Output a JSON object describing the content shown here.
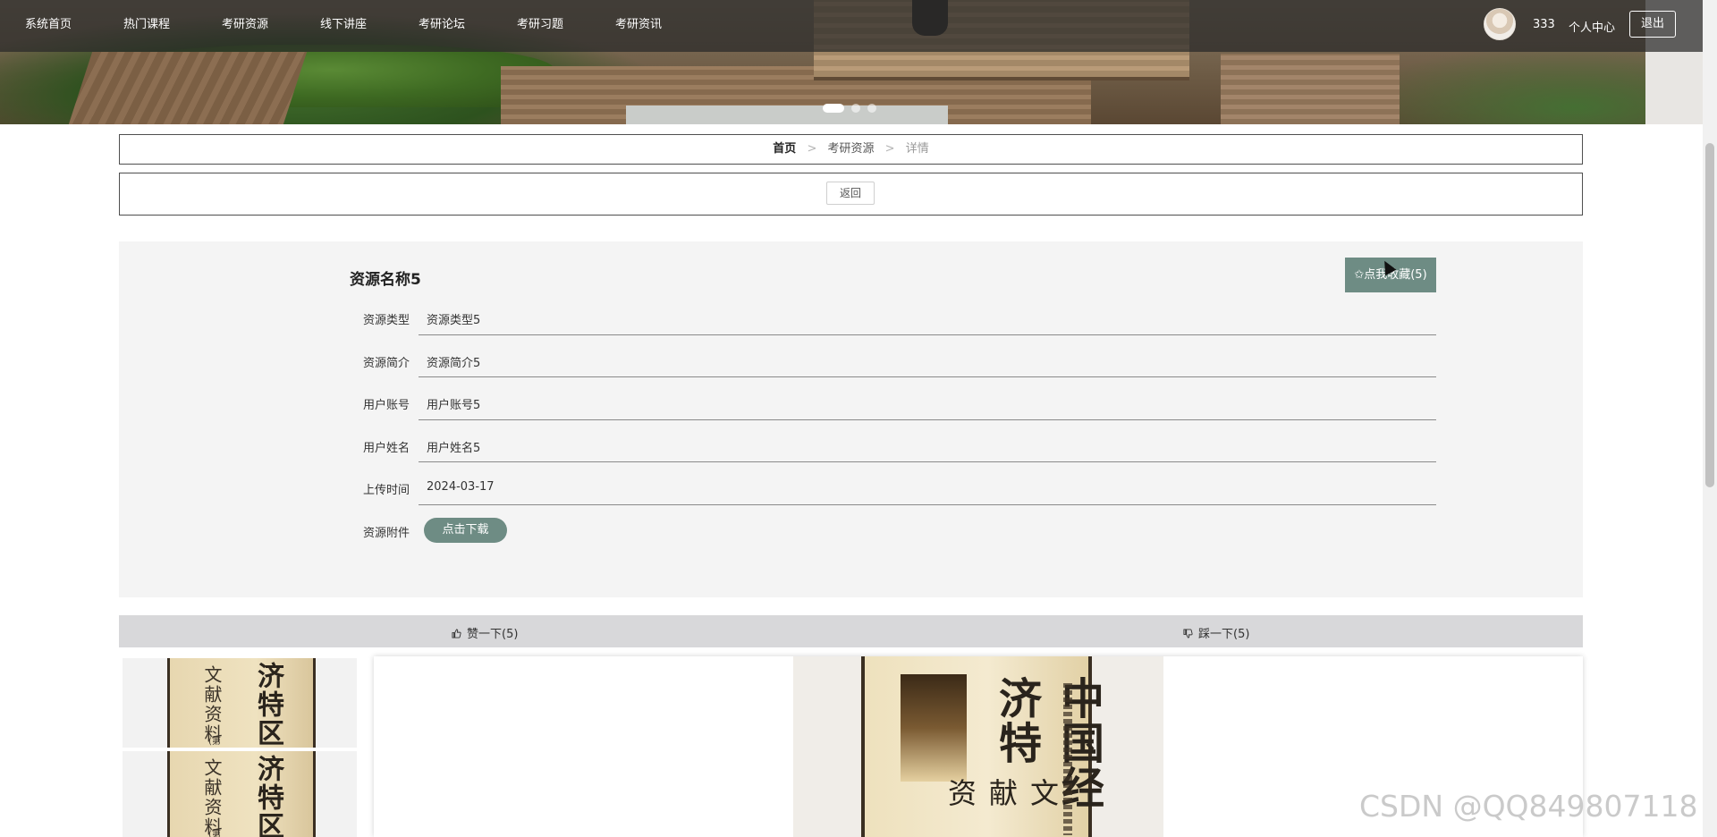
{
  "nav": {
    "items": [
      {
        "label": "系统首页"
      },
      {
        "label": "热门课程"
      },
      {
        "label": "考研资源"
      },
      {
        "label": "线下讲座"
      },
      {
        "label": "考研论坛"
      },
      {
        "label": "考研习题"
      },
      {
        "label": "考研资讯"
      }
    ],
    "username": "333",
    "personal_center": "个人中心",
    "logout": "退出"
  },
  "carousel": {
    "slides": 3,
    "active": 1
  },
  "breadcrumb": {
    "home": "首页",
    "section": "考研资源",
    "current": "详情",
    "separator": ">"
  },
  "back_label": "返回",
  "resource": {
    "title": "资源名称5",
    "favorite_label": "✩点我收藏(5)",
    "fields": [
      {
        "label": "资源类型",
        "value": "资源类型5"
      },
      {
        "label": "资源简介",
        "value": "资源简介5"
      },
      {
        "label": "用户账号",
        "value": "用户账号5"
      },
      {
        "label": "用户姓名",
        "value": "用户姓名5"
      },
      {
        "label": "上传时间",
        "value": "2024-03-17"
      }
    ],
    "attachment_label": "资源附件",
    "download_label": "点击下载"
  },
  "votes": {
    "like_label": "赞一下(5)",
    "dislike_label": "踩一下(5)"
  },
  "book": {
    "thumb_big": "济特区",
    "thumb_small": "文献资料",
    "thumb_tail": "(第",
    "main_big": "中国经济特",
    "main_small": "文献资"
  },
  "watermark": "CSDN @QQ849807118",
  "colors": {
    "accent": "#6e8c84",
    "panel": "#f4f4f4",
    "vote_bar": "#d8d8da"
  }
}
